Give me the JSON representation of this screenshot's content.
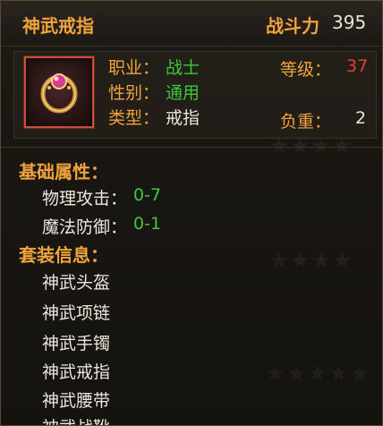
{
  "item": {
    "name": "神武戒指",
    "power_label": "战斗力",
    "power_value": "395",
    "icon": "ring-icon"
  },
  "info": {
    "class_label": "职业：",
    "class_value": "战士",
    "gender_label": "性别：",
    "gender_value": "通用",
    "type_label": "类型：",
    "type_value": "戒指",
    "level_label": "等级：",
    "level_value": "37",
    "weight_label": "负重：",
    "weight_value": "2"
  },
  "base_attributes": {
    "title": "基础属性：",
    "stats": [
      {
        "name": "物理攻击：",
        "value": "0-7"
      },
      {
        "name": "魔法防御：",
        "value": "0-1"
      }
    ]
  },
  "set_info": {
    "title": "套装信息：",
    "pieces": [
      "神武头盔",
      "神武项链",
      "神武手镯",
      "神武戒指",
      "神武腰带",
      "神武战靴"
    ]
  },
  "colors": {
    "title_gold": "#f0a33c",
    "value_green": "#3ec83a",
    "level_red": "#e0402c",
    "text_white": "#ece7dd"
  }
}
